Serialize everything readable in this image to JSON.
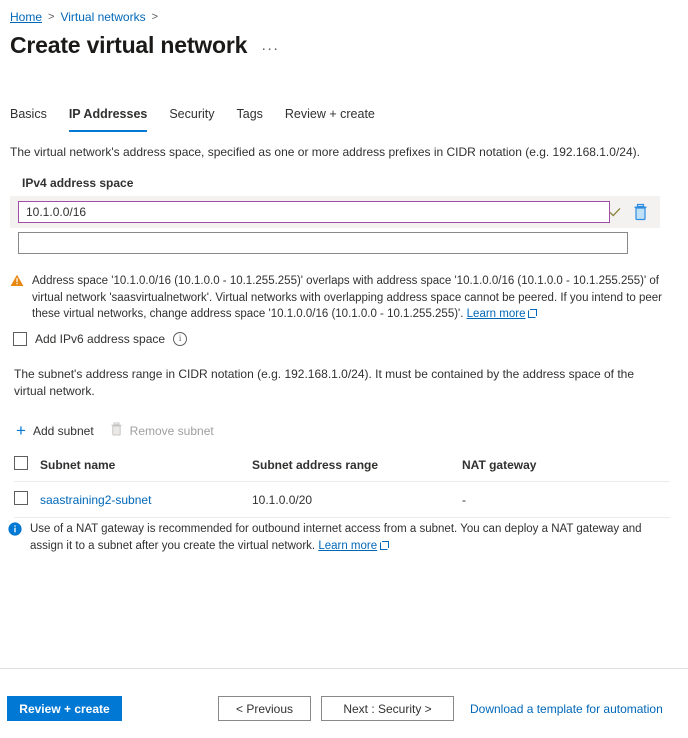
{
  "breadcrumb": {
    "items": [
      {
        "label": "Home"
      },
      {
        "label": "Virtual networks"
      }
    ],
    "separator": ">"
  },
  "header": {
    "title": "Create virtual network",
    "ellipsis": "···"
  },
  "tabs": [
    {
      "label": "Basics",
      "active": false
    },
    {
      "label": "IP Addresses",
      "active": true
    },
    {
      "label": "Security",
      "active": false
    },
    {
      "label": "Tags",
      "active": false
    },
    {
      "label": "Review + create",
      "active": false
    }
  ],
  "address_space": {
    "description": "The virtual network's address space, specified as one or more address prefixes in CIDR notation (e.g. 192.168.1.0/24).",
    "section_label": "IPv4 address space",
    "rows": [
      {
        "value": "10.1.0.0/16",
        "placeholder": "",
        "valid": true,
        "delete_label": "delete-address-space"
      },
      {
        "value": "",
        "placeholder": "",
        "valid": false
      }
    ],
    "warning": {
      "icon": "warning-icon",
      "text": "Address space '10.1.0.0/16 (10.1.0.0 - 10.1.255.255)' overlaps with address space '10.1.0.0/16 (10.1.0.0 - 10.1.255.255)' of virtual network 'saasvirtualnetwork'. Virtual networks with overlapping address space cannot be peered. If you intend to peer these virtual networks, change address space '10.1.0.0/16 (10.1.0.0 - 10.1.255.255)'.",
      "link_label": "Learn more"
    },
    "ipv6": {
      "label": "Add IPv6 address space",
      "checked": false,
      "info_glyph": "i"
    }
  },
  "subnets": {
    "description": "The subnet's address range in CIDR notation (e.g. 192.168.1.0/24). It must be contained by the address space of the virtual network.",
    "toolbar": {
      "add_label": "Add subnet",
      "add_icon": "plus-icon",
      "remove_label": "Remove subnet",
      "remove_icon": "trash-icon",
      "remove_disabled": true
    },
    "columns": [
      "Subnet name",
      "Subnet address range",
      "NAT gateway"
    ],
    "rows": [
      {
        "name": "saastraining2-subnet",
        "range": "10.1.0.0/20",
        "nat_gateway": "-",
        "selected": false
      }
    ],
    "info_banner": {
      "icon": "info-icon",
      "text": "Use of a NAT gateway is recommended for outbound internet access from a subnet. You can deploy a NAT gateway and assign it to a subnet after you create the virtual network.",
      "link_label": "Learn more"
    }
  },
  "footer": {
    "review_create": "Review + create",
    "previous": "< Previous",
    "next": "Next : Security >",
    "download_template": "Download a template for automation"
  },
  "colors": {
    "accent": "#0078d4",
    "link": "#0067b8",
    "focus_border": "#a24ca6",
    "warning": "#ff8c00",
    "valid_check": "#888236",
    "shaded_row": "#f3f2f1",
    "divider": "#edebe9"
  }
}
